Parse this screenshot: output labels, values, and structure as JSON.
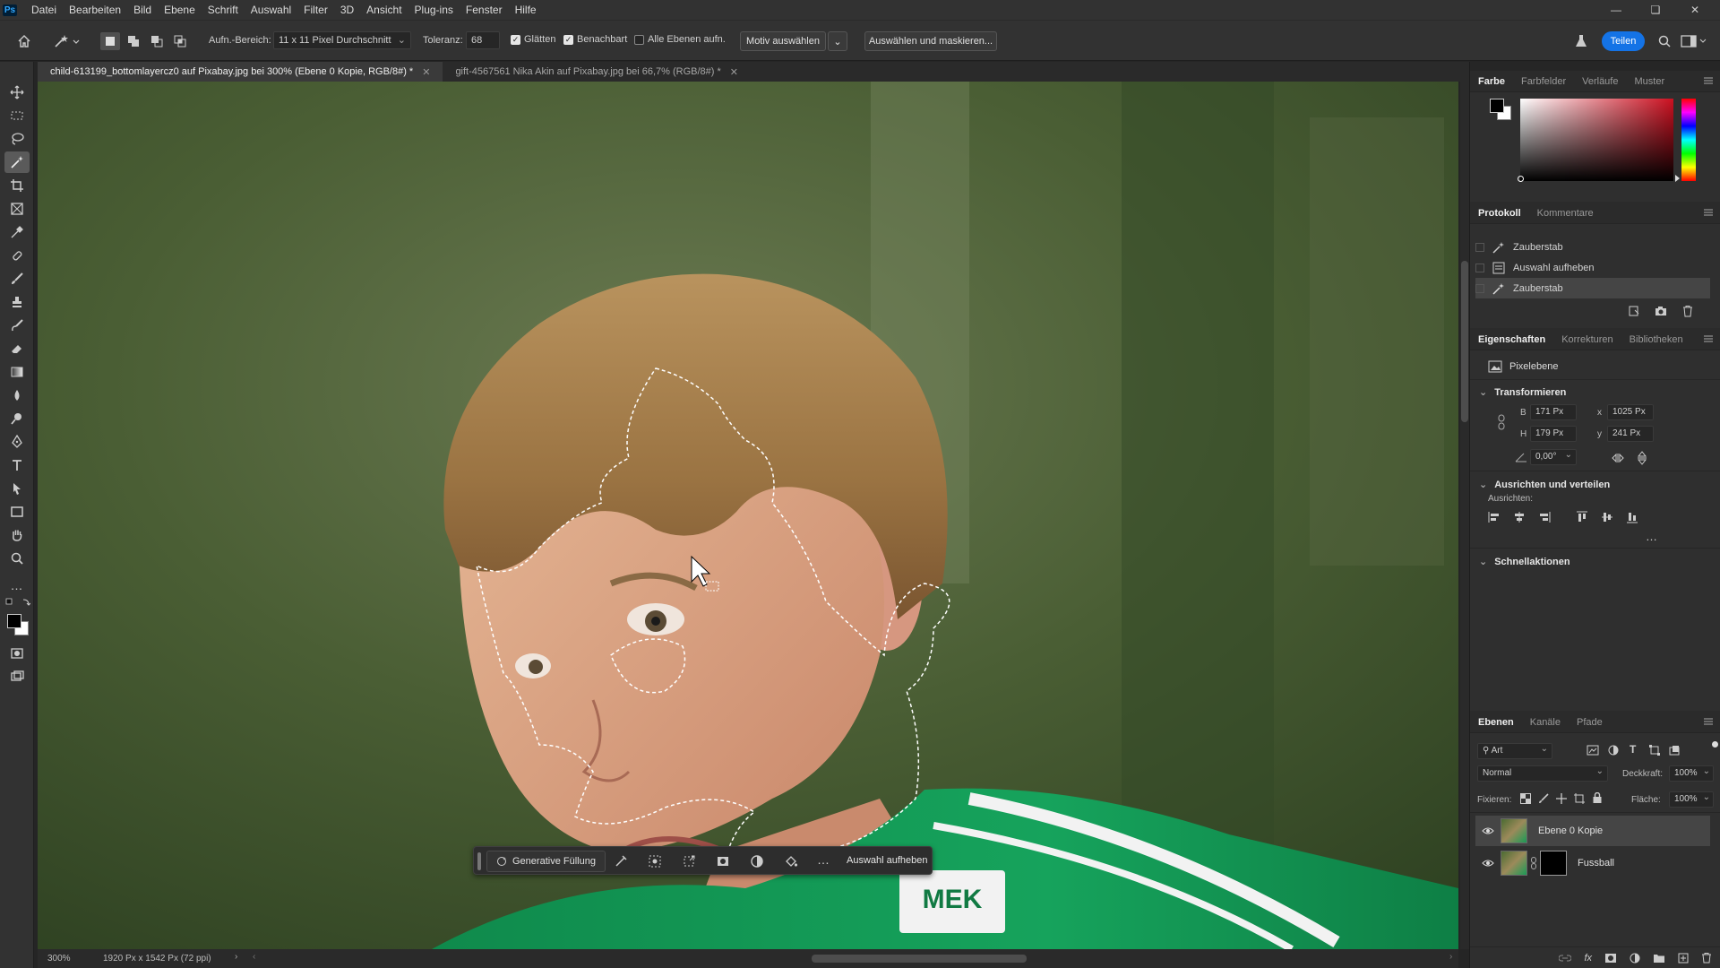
{
  "app": {
    "logo": "Ps",
    "accent": "#31a8ff"
  },
  "menubar": {
    "items": [
      "Datei",
      "Bearbeiten",
      "Bild",
      "Ebene",
      "Schrift",
      "Auswahl",
      "Filter",
      "3D",
      "Ansicht",
      "Plug-ins",
      "Fenster",
      "Hilfe"
    ]
  },
  "options": {
    "sample_label": "Aufn.-Bereich:",
    "sample_value": "11 x 11 Pixel Durchschnitt",
    "tolerance_label": "Toleranz:",
    "tolerance_value": "68",
    "antialias_label": "Glätten",
    "antialias_checked": true,
    "contiguous_label": "Benachbart",
    "contiguous_checked": true,
    "all_layers_label": "Alle Ebenen aufn.",
    "all_layers_checked": false,
    "select_subject": "Motiv auswählen",
    "select_mask": "Auswählen und maskieren...",
    "share": "Teilen"
  },
  "tabs": [
    {
      "label": "child-613199_bottomlayercz0 auf Pixabay.jpg bei 300% (Ebene 0 Kopie, RGB/8#) *",
      "active": true
    },
    {
      "label": "gift-4567561 Nika Akin auf Pixabay.jpg bei 66,7% (RGB/8#) *",
      "active": false
    }
  ],
  "status": {
    "zoom": "300%",
    "doc_info": "1920 Px x 1542 Px (72 ppi)"
  },
  "context_bar": {
    "generative_fill": "Generative Füllung",
    "deselect": "Auswahl aufheben"
  },
  "color_panel": {
    "tabs": [
      "Farbe",
      "Farbfelder",
      "Verläufe",
      "Muster"
    ],
    "active": 0,
    "hue_color": "#cc1020"
  },
  "history_panel": {
    "tabs": [
      "Protokoll",
      "Kommentare"
    ],
    "active": 0,
    "items": [
      {
        "label": "Zauberstab",
        "icon": "magic-wand-icon",
        "selected": false
      },
      {
        "label": "Auswahl aufheben",
        "icon": "document-icon",
        "selected": false
      },
      {
        "label": "Zauberstab",
        "icon": "magic-wand-icon",
        "selected": true
      }
    ]
  },
  "properties_panel": {
    "tabs": [
      "Eigenschaften",
      "Korrekturen",
      "Bibliotheken"
    ],
    "active": 0,
    "kind": "Pixelebene",
    "transform_title": "Transformieren",
    "w_label": "B",
    "w_value": "171 Px",
    "h_label": "H",
    "h_value": "179 Px",
    "x_label": "x",
    "x_value": "1025 Px",
    "y_label": "y",
    "y_value": "241 Px",
    "angle_value": "0,00°",
    "align_title": "Ausrichten und verteilen",
    "align_label": "Ausrichten:",
    "quick_title": "Schnellaktionen"
  },
  "layers_panel": {
    "tabs": [
      "Ebenen",
      "Kanäle",
      "Pfade"
    ],
    "active": 0,
    "filter_label": "Art",
    "blend_mode": "Normal",
    "opacity_label": "Deckkraft:",
    "opacity_value": "100%",
    "lock_label": "Fixieren:",
    "fill_label": "Fläche:",
    "fill_value": "100%",
    "layers": [
      {
        "name": "Ebene 0 Kopie",
        "visible": true,
        "selected": true,
        "has_mask": false
      },
      {
        "name": "Fussball",
        "visible": true,
        "selected": false,
        "has_mask": true
      }
    ]
  },
  "image_text": {
    "shirt_logo": "MEK"
  }
}
